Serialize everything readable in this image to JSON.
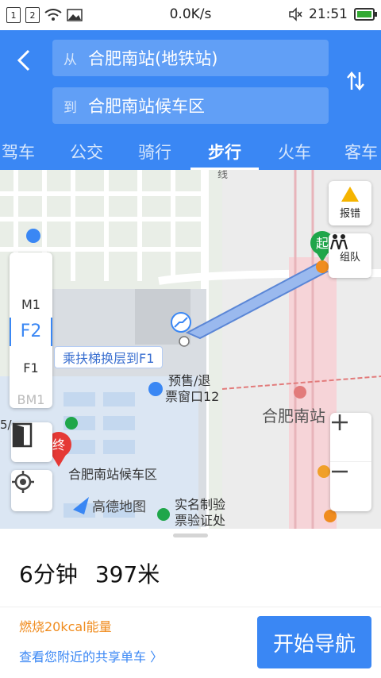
{
  "status_bar": {
    "sim1": "1",
    "sim2": "2",
    "speed": "0.0K/s",
    "time": "21:51"
  },
  "route": {
    "from_prefix": "从",
    "from_value": "合肥南站(地铁站)",
    "to_prefix": "到",
    "to_value": "合肥南站候车区"
  },
  "tabs": [
    {
      "label": "驾车"
    },
    {
      "label": "公交"
    },
    {
      "label": "骑行"
    },
    {
      "label": "步行"
    },
    {
      "label": "火车"
    },
    {
      "label": "客车"
    }
  ],
  "active_tab": "步行",
  "map": {
    "report_label": "报错",
    "team_label": "组队",
    "floors": [
      "M1",
      "F2",
      "F1",
      "BM1"
    ],
    "active_floor": "F2",
    "tip": "乘扶梯换层到F1",
    "poi_ticket": "预售/退\n票窗口12",
    "poi_ticket_l1": "预售/退",
    "poi_ticket_l2": "票窗口12",
    "poi_station": "合肥南站",
    "poi_waiting": "合肥南站候车区",
    "poi_realname_l1": "实名制验",
    "poi_realname_l2": "票验证处",
    "brand": "高德地图",
    "start_marker": "起",
    "end_marker": "终",
    "line_label": "线",
    "ticket_stub": "5/"
  },
  "summary": {
    "duration": "6分钟",
    "distance": "397米",
    "calories": "燃烧20kcal能量",
    "bike_link": "查看您附近的共享单车 〉",
    "start_nav": "开始导航"
  },
  "colors": {
    "brand_blue": "#3a87f4",
    "accent_orange": "#f08c1e",
    "start_green": "#1fa64a",
    "end_red": "#e53935"
  }
}
